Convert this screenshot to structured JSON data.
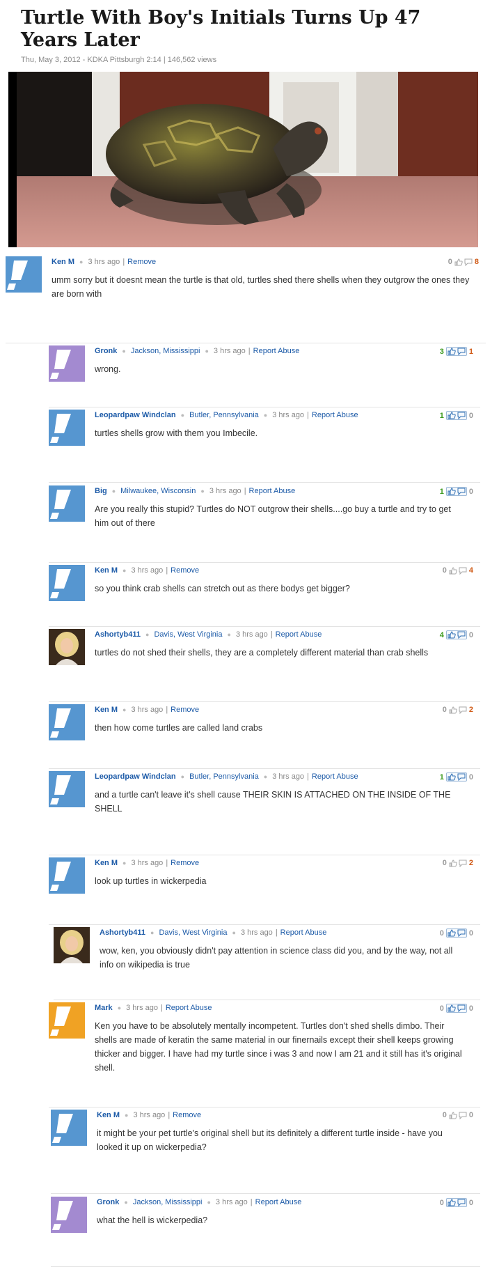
{
  "article": {
    "title": "Turtle With Boy's Initials Turns Up 47 Years Later",
    "meta": "Thu, May 3, 2012 - KDKA Pittsburgh 2:14 | 146,562 views"
  },
  "colors": {
    "link": "#1d5ba8",
    "up_positive": "#3d9a1e",
    "down_negative": "#d05a16",
    "avatar_blue": "#5696d0",
    "avatar_purple": "#a38ad0",
    "avatar_orange": "#f0a224"
  },
  "comments": [
    {
      "author": "Ken M",
      "location": "",
      "time": "3 hrs ago",
      "action": "Remove",
      "up": "0",
      "down": "8",
      "avatar": "avatar_blue",
      "text": "umm sorry but it doesnt mean the turtle is that old, turtles shed there shells when they outgrow the ones they are born with"
    },
    {
      "author": "Gronk",
      "location": "Jackson, Mississippi",
      "time": "3 hrs ago",
      "action": "Report Abuse",
      "up": "3",
      "down": "1",
      "avatar": "avatar_purple",
      "text": "wrong."
    },
    {
      "author": "Leopardpaw Windclan",
      "location": "Butler, Pennsylvania",
      "time": "3 hrs ago",
      "action": "Report Abuse",
      "up": "1",
      "down": "0",
      "avatar": "avatar_blue",
      "text": "turtles shells grow with them you Imbecile."
    },
    {
      "author": "Big",
      "location": "Milwaukee, Wisconsin",
      "time": "3 hrs ago",
      "action": "Report Abuse",
      "up": "1",
      "down": "0",
      "avatar": "avatar_blue",
      "text": "Are you really this stupid? Turtles do NOT outgrow their shells....go buy a turtle and try to get him out of there"
    },
    {
      "author": "Ken M",
      "location": "",
      "time": "3 hrs ago",
      "action": "Remove",
      "up": "0",
      "down": "4",
      "avatar": "avatar_blue",
      "text": "so you think crab shells can stretch out as there bodys get bigger?"
    },
    {
      "author": "Ashortyb411",
      "location": "Davis, West Virginia",
      "time": "3 hrs ago",
      "action": "Report Abuse",
      "up": "4",
      "down": "0",
      "avatar": "photo",
      "text": "turtles do not shed their shells, they are a completely different material than crab shells"
    },
    {
      "author": "Ken M",
      "location": "",
      "time": "3 hrs ago",
      "action": "Remove",
      "up": "0",
      "down": "2",
      "avatar": "avatar_blue",
      "text": "then how come turtles are called land crabs"
    },
    {
      "author": "Leopardpaw Windclan",
      "location": "Butler, Pennsylvania",
      "time": "3 hrs ago",
      "action": "Report Abuse",
      "up": "1",
      "down": "0",
      "avatar": "avatar_blue",
      "text": "and a turtle can't leave it's shell cause THEIR SKIN IS ATTACHED ON THE INSIDE OF THE SHELL"
    },
    {
      "author": "Ken M",
      "location": "",
      "time": "3 hrs ago",
      "action": "Remove",
      "up": "0",
      "down": "2",
      "avatar": "avatar_blue",
      "text": "look up turtles in wickerpedia"
    },
    {
      "author": "Ashortyb411",
      "location": "Davis, West Virginia",
      "time": "3 hrs ago",
      "action": "Report Abuse",
      "up": "0",
      "down": "0",
      "avatar": "photo",
      "text": "wow, ken, you obviously didn't pay attention in science class did you, and by the way, not all info on wikipedia is true"
    },
    {
      "author": "Mark",
      "location": "",
      "time": "3 hrs ago",
      "action": "Report Abuse",
      "up": "0",
      "down": "0",
      "avatar": "avatar_orange",
      "text": "Ken you have to be absolutely mentally incompetent. Turtles don't shed shells dimbo. Their shells are made of keratin the same material in our finernails except their shell keeps growing thicker and bigger. I have had my turtle since i was 3 and now I am 21 and it still has it's original shell."
    },
    {
      "author": "Ken M",
      "location": "",
      "time": "3 hrs ago",
      "action": "Remove",
      "up": "0",
      "down": "0",
      "avatar": "avatar_blue",
      "text": "it might be your pet turtle's original shell but its definitely a different turtle inside - have you looked it up on wickerpedia?"
    },
    {
      "author": "Gronk",
      "location": "Jackson, Mississippi",
      "time": "3 hrs ago",
      "action": "Report Abuse",
      "up": "0",
      "down": "0",
      "avatar": "avatar_purple",
      "text": "what the hell is wickerpedia?"
    }
  ]
}
